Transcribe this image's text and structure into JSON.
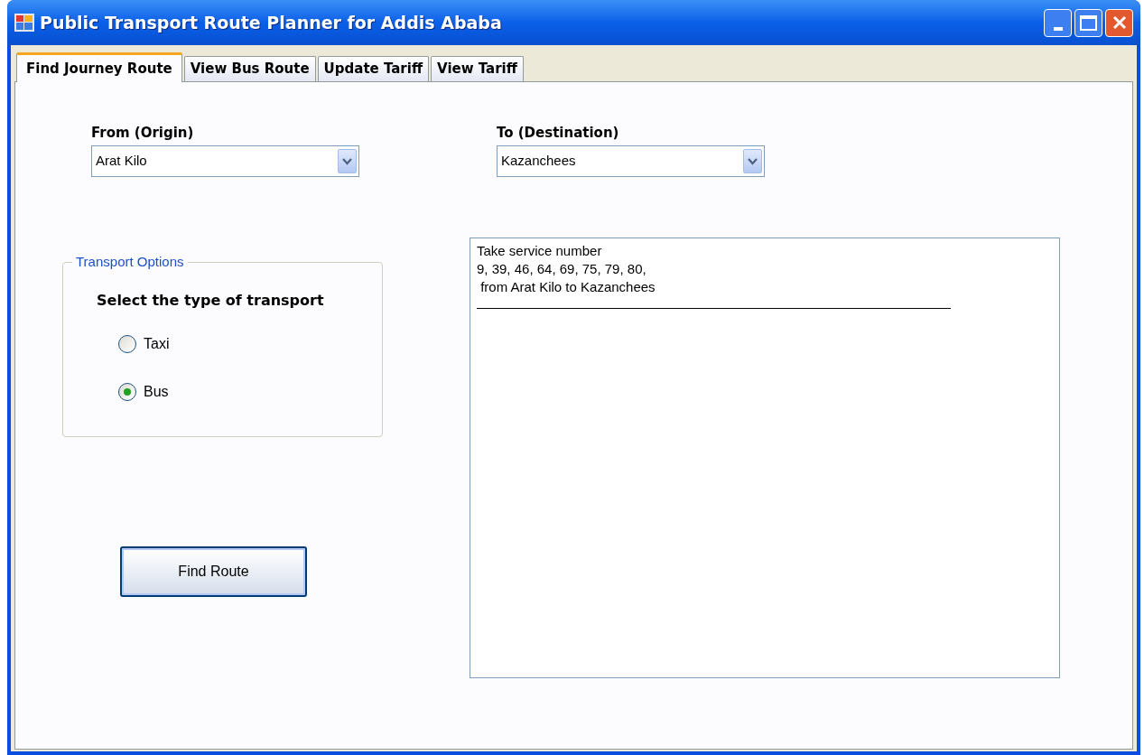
{
  "window": {
    "title": "Public Transport Route Planner for Addis Ababa"
  },
  "tabs": [
    {
      "label": "Find Journey Route",
      "selected": true
    },
    {
      "label": "View Bus Route",
      "selected": false
    },
    {
      "label": "Update Tariff",
      "selected": false
    },
    {
      "label": "View Tariff",
      "selected": false
    }
  ],
  "origin": {
    "label": "From (Origin)",
    "value": "Arat Kilo"
  },
  "destination": {
    "label": "To (Destination)",
    "value": "Kazanchees"
  },
  "transport_options": {
    "title": "Transport Options",
    "prompt": "Select the type of transport",
    "options": [
      {
        "label": "Taxi",
        "selected": false
      },
      {
        "label": "Bus",
        "selected": true
      }
    ]
  },
  "find_button": "Find Route",
  "result": {
    "lines": [
      "Take service number",
      "9, 39, 46, 64, 69, 75, 79, 80,",
      " from Arat Kilo to Kazanchees"
    ]
  }
}
